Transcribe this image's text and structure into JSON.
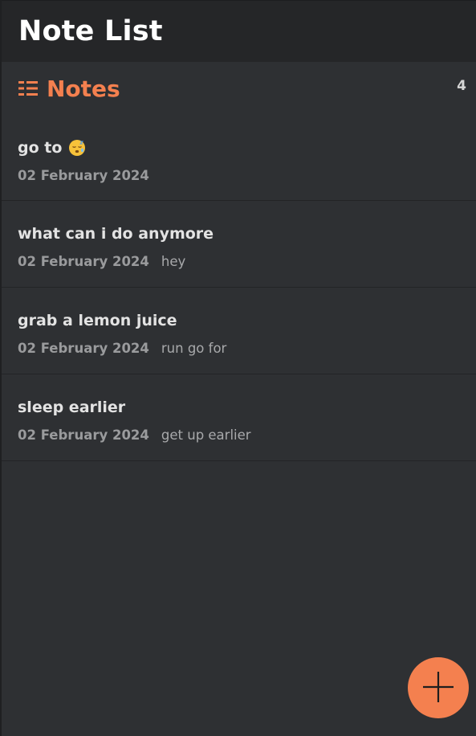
{
  "header": {
    "title": "Note List"
  },
  "section": {
    "icon": "list-icon",
    "title": "Notes",
    "count": "4"
  },
  "notes": [
    {
      "title": "go to",
      "emoji": "sleeping-face-emoji",
      "date": "02 February 2024",
      "preview": ""
    },
    {
      "title": "what can i do anymore",
      "date": "02 February 2024",
      "preview": "hey"
    },
    {
      "title": "grab a lemon juice",
      "date": "02 February 2024",
      "preview": "run go for"
    },
    {
      "title": "sleep earlier",
      "date": "02 February 2024",
      "preview": "get up earlier"
    }
  ],
  "fab": {
    "icon": "plus-icon"
  },
  "colors": {
    "accent": "#f4804f",
    "background": "#2e3033",
    "topbar": "#252628"
  }
}
